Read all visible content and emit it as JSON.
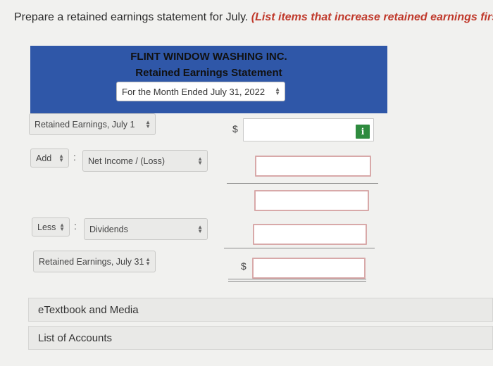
{
  "instruction": {
    "text": "Prepare a retained earnings statement for July.",
    "emphasis": "(List items that increase retained earnings first.)"
  },
  "header": {
    "company": "FLINT WINDOW WASHING INC.",
    "statement_title": "Retained Earnings Statement",
    "period_dropdown": "For the Month Ended July 31, 2022"
  },
  "rows": {
    "beginning": {
      "label": "Retained Earnings, July 1",
      "currency": "$",
      "amount": ""
    },
    "add": {
      "operator": "Add",
      "separator": ":",
      "item": "Net Income / (Loss)",
      "amount": ""
    },
    "subtotal": {
      "amount": ""
    },
    "less": {
      "operator": "Less",
      "separator": ":",
      "item": "Dividends",
      "amount": ""
    },
    "ending": {
      "label": "Retained Earnings, July 31",
      "currency": "$",
      "amount": ""
    }
  },
  "links": {
    "etextbook": "eTextbook and Media",
    "accounts": "List of Accounts"
  },
  "colors": {
    "header_bg": "#2f57a8",
    "emphasis": "#c0392b",
    "info_badge": "#2e8b3e"
  },
  "icons": {
    "dropdown": "updown-arrows-icon",
    "info": "info-icon"
  }
}
